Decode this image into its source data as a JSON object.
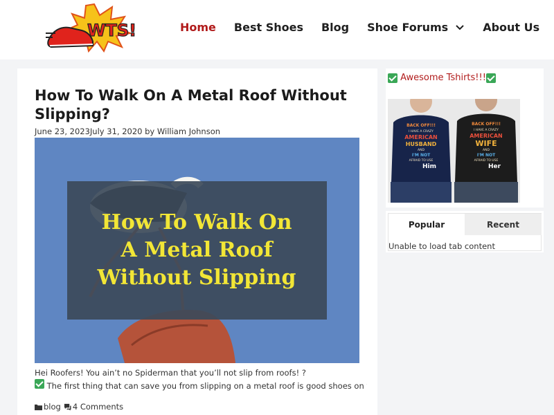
{
  "header": {
    "logo_text": "WTS!",
    "nav": [
      {
        "label": "Home",
        "active": true
      },
      {
        "label": "Best Shoes"
      },
      {
        "label": "Blog"
      },
      {
        "label": "Shoe Forums",
        "has_dropdown": true
      },
      {
        "label": "About Us"
      }
    ]
  },
  "article": {
    "title": "How To Walk On A Metal Roof Without Slipping?",
    "dates": "June 23, 2023July 31, 2020",
    "by": "by",
    "author": "William Johnson",
    "hero_text": [
      "How To Walk On",
      "A Metal Roof",
      "Without Slipping"
    ],
    "excerpt_line1": "Hei Roofers! You ain’t no Spiderman that you’ll not slip from roofs! ?",
    "excerpt_line2": "The first thing that can save you from slipping on a metal roof is good shoes on your",
    "category": "blog",
    "comments": "4 Comments"
  },
  "sidebar": {
    "shirts_title": "Awesome Tshirts!!!",
    "shirt_texts": {
      "left": [
        "BACK OFF!!!",
        "I HAVE A CRAZY",
        "AMERICAN",
        "HUSBAND",
        "AND",
        "I'M NOT",
        "AFRAID TO USE",
        "Him"
      ],
      "right": [
        "BACK OFF!!!",
        "I HAVE A CRAZY",
        "AMERICAN",
        "WIFE",
        "AND",
        "I'M NOT",
        "AFRAID TO USE",
        "Her"
      ]
    },
    "tabs": [
      {
        "label": "Popular"
      },
      {
        "label": "Recent"
      }
    ],
    "tab_message": "Unable to load tab content"
  },
  "colors": {
    "accent": "#b11b1b",
    "check": "#3aa757",
    "hero_sky": "#5f86c2",
    "hero_text": "#f2e636"
  }
}
